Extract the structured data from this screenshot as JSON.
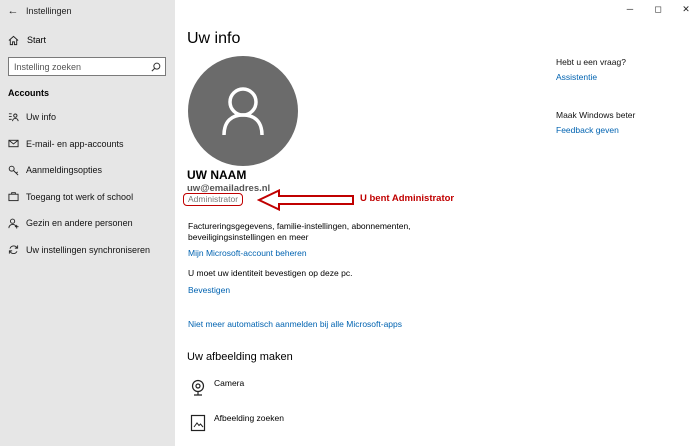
{
  "window": {
    "app_title": "Instellingen",
    "controls": {
      "minimize": "─",
      "maximize": "◻",
      "close": "✕"
    }
  },
  "sidebar": {
    "back_glyph": "←",
    "home_label": "Start",
    "search": {
      "placeholder": "Instelling zoeken",
      "value": ""
    },
    "section_title": "Accounts",
    "items": [
      {
        "label": "Uw info",
        "icon": "person-card-icon"
      },
      {
        "label": "E-mail- en app-accounts",
        "icon": "mail-icon"
      },
      {
        "label": "Aanmeldingsopties",
        "icon": "key-icon"
      },
      {
        "label": "Toegang tot werk of school",
        "icon": "briefcase-icon"
      },
      {
        "label": "Gezin en andere personen",
        "icon": "add-person-icon"
      },
      {
        "label": "Uw instellingen synchroniseren",
        "icon": "sync-icon"
      }
    ]
  },
  "main": {
    "title": "Uw info",
    "user": {
      "name": "UW NAAM",
      "email": "uw@emailadres.nl",
      "role": "Administrator"
    },
    "annotation": "U bent Administrator",
    "billing_text": "Factureringsgegevens, familie-instellingen, abonnementen, beveiligingsinstellingen en meer",
    "manage_link": "Mijn Microsoft-account beheren",
    "verify_text": "U moet uw identiteit bevestigen op deze pc.",
    "verify_link": "Bevestigen",
    "auto_signin_link": "Niet meer automatisch aanmelden bij alle Microsoft-apps",
    "picture_section": {
      "title": "Uw afbeelding maken",
      "options": [
        {
          "label": "Camera",
          "icon": "camera-icon"
        },
        {
          "label": "Afbeelding zoeken",
          "icon": "browse-icon"
        }
      ]
    }
  },
  "rail": {
    "question_title": "Hebt u een vraag?",
    "assist_link": "Assistentie",
    "improve_title": "Maak Windows beter",
    "feedback_link": "Feedback geven"
  },
  "colors": {
    "accent": "#0063b1",
    "annotation": "#c00000",
    "sidebar_bg": "#e6e6e6",
    "avatar_bg": "#6b6b6b"
  }
}
